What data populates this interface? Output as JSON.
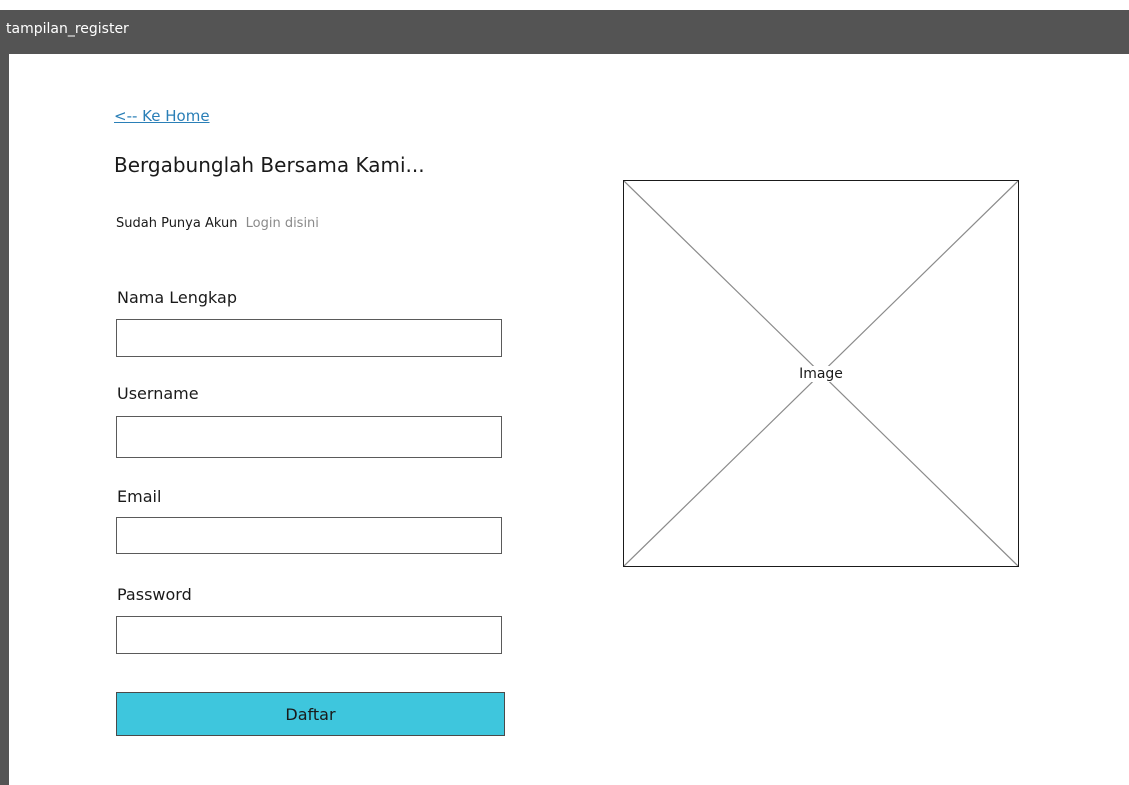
{
  "window": {
    "title": "tampilan_register"
  },
  "nav": {
    "home_link": "<-- Ke Home"
  },
  "header": {
    "title": "Bergabunglah Bersama Kami..."
  },
  "login": {
    "prompt": "Sudah Punya Akun",
    "link": "Login disini"
  },
  "form": {
    "fields": [
      {
        "label": "Nama Lengkap",
        "value": ""
      },
      {
        "label": "Username",
        "value": ""
      },
      {
        "label": "Email",
        "value": ""
      },
      {
        "label": "Password",
        "value": ""
      }
    ],
    "submit_label": "Daftar"
  },
  "image": {
    "label": "Image"
  },
  "colors": {
    "titlebar": "#545454",
    "link": "#2a7fb7",
    "button": "#3ec6dd"
  }
}
